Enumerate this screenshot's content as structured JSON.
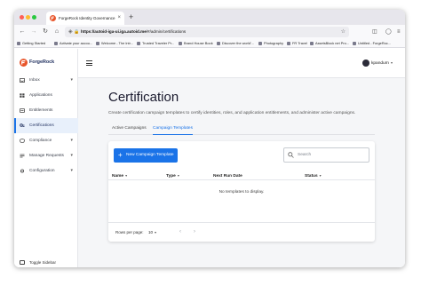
{
  "browser": {
    "tab_title": "ForgeRock Identity Governance",
    "tab_close": "×",
    "new_tab": "+",
    "url_host": "https://autoid-iga-ui.iga.autoid.me",
    "url_path": "/#/admin/certifications",
    "bookmarks": [
      "Getting Started",
      "Activate your accou...",
      "Welcome - The Intr...",
      "Trusted Traveler Pr...",
      "Brand House Book",
      "Discover the world'...",
      "Photography",
      "FR Travel",
      "AssetsBlock net Pro...",
      "Untitled - ForgeRoc..."
    ]
  },
  "sidebar": {
    "logo_text": "ForgeRock",
    "items": [
      {
        "label": "Inbox",
        "chevron": "▾"
      },
      {
        "label": "Applications",
        "chevron": ""
      },
      {
        "label": "Entitlements",
        "chevron": ""
      },
      {
        "label": "Certifications",
        "chevron": ""
      },
      {
        "label": "Compliance",
        "chevron": "▾"
      },
      {
        "label": "Manage Requests",
        "chevron": "▾"
      },
      {
        "label": "Configuration",
        "chevron": "▾"
      }
    ],
    "active_index": 3,
    "toggle_label": "Toggle Sidebar"
  },
  "header": {
    "user_name": "kpandurn",
    "user_caret": "▾"
  },
  "main": {
    "title": "Certification",
    "subtitle": "Create certification campaign templates to certify identities, roles, and application entitlements, and administer active campaigns.",
    "tabs": [
      {
        "label": "Active Campaigns",
        "active": false
      },
      {
        "label": "Campaign Templates",
        "active": true
      }
    ],
    "new_button_label": "New Campaign Template",
    "new_button_icon": "+",
    "search_placeholder": "Search",
    "columns": [
      {
        "label": "Name",
        "caret": "▾"
      },
      {
        "label": "Type",
        "caret": "▾"
      },
      {
        "label": "Next Run Date",
        "caret": ""
      },
      {
        "label": "Status",
        "caret": "▾"
      }
    ],
    "empty_message": "No templates to display.",
    "rows_per_page_label": "Rows per page:",
    "rows_per_page_value": "10",
    "rows_per_page_caret": "▾",
    "prev_page": "‹",
    "next_page": "›"
  },
  "colors": {
    "accent": "#1a73e8",
    "active_bg": "#e8f0fb",
    "brand_logo": "#1c2c5c"
  }
}
